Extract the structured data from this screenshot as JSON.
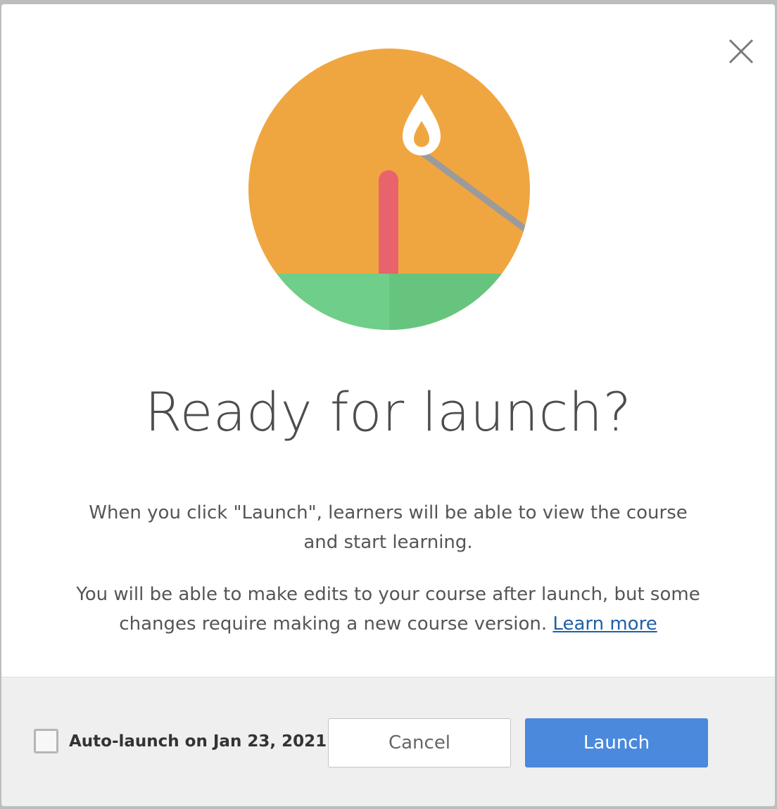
{
  "dialog": {
    "title": "Ready for launch?",
    "paragraph1": "When you click \"Launch\", learners will be able to view the course and start learning.",
    "paragraph2": "You will be able to make edits to your course after launch, but some changes require making a new course version.",
    "learn_more": "Learn more",
    "close_icon": "close-icon",
    "illustration": "lit-match-candle-illustration"
  },
  "footer": {
    "auto_launch_label": "Auto-launch on Jan 23, 2021",
    "auto_launch_checked": false,
    "cancel_label": "Cancel",
    "launch_label": "Launch"
  },
  "colors": {
    "circle": "#f0a640",
    "ground_light": "#6fce8a",
    "ground_dark": "#66c47f",
    "candle": "#e8636b",
    "match_stick": "#9b9b9b",
    "flame": "#ffffff",
    "primary_button": "#4a89dc",
    "link": "#1f5fa8"
  }
}
